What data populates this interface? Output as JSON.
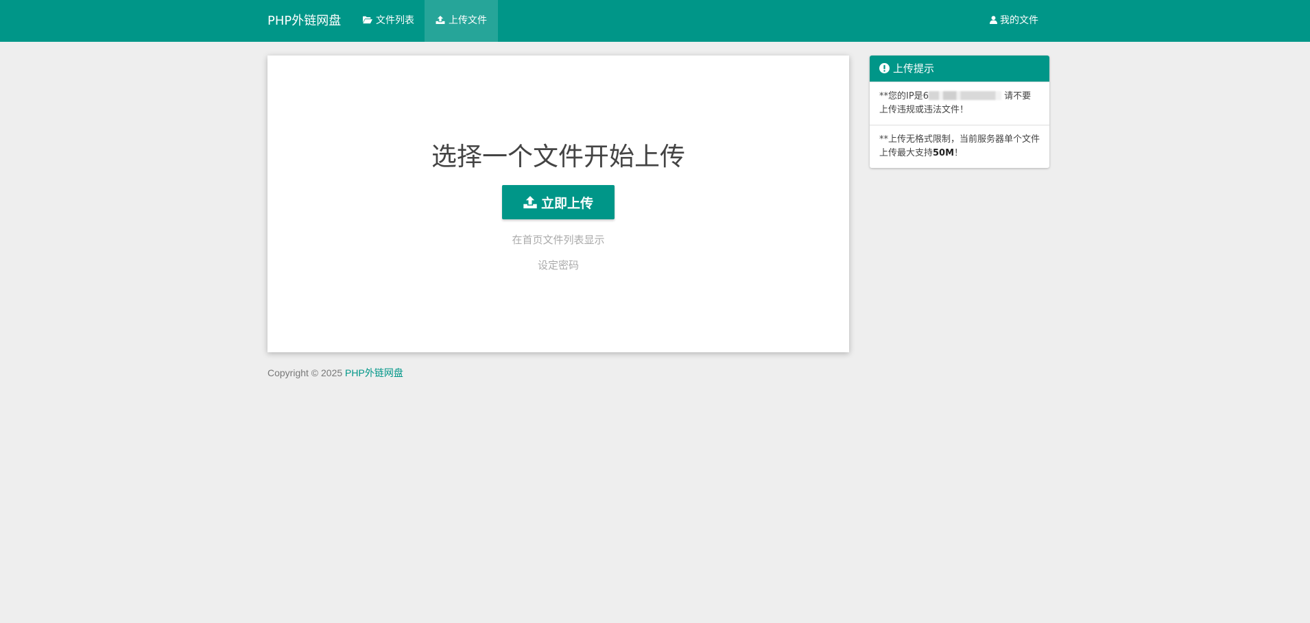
{
  "navbar": {
    "brand": "PHP外链网盘",
    "items": [
      {
        "label": "文件列表",
        "icon": "folder-open-icon"
      },
      {
        "label": "上传文件",
        "icon": "upload-icon",
        "active": true
      }
    ],
    "right_item": {
      "label": "我的文件",
      "icon": "user-icon"
    },
    "color": "#009688"
  },
  "main": {
    "title": "选择一个文件开始上传",
    "upload_button": "立即上传",
    "option_show_on_home": "在首页文件列表显示",
    "option_set_password": "设定密码"
  },
  "footer": {
    "copyright": "Copyright © 2025",
    "site_link": "PHP外链网盘"
  },
  "panel": {
    "title": "上传提示",
    "notice1_prefix": "**您的IP是",
    "notice1_ip_first_char": "6",
    "notice1_suffix": " 请不要上传违规或违法文件！",
    "notice2_prefix": "**上传无格式限制，当前服务器单个文件上传最大支持",
    "notice2_size": "50M",
    "notice2_suffix": "！"
  }
}
